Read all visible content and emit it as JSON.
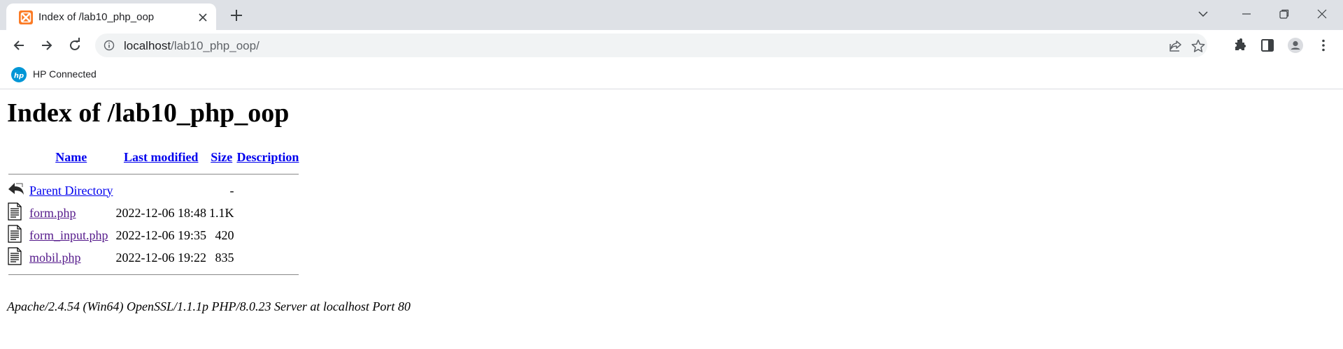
{
  "browser": {
    "tab": {
      "title": "Index of /lab10_php_oop",
      "favicon": "xampp-icon"
    },
    "address_bar": {
      "host": "localhost",
      "path": "/lab10_php_oop/"
    },
    "bookmarks": [
      {
        "label": "HP Connected",
        "icon": "hp-logo-icon"
      }
    ]
  },
  "page": {
    "heading": "Index of /lab10_php_oop",
    "columns": {
      "name": "Name",
      "last_modified": "Last modified",
      "size": "Size",
      "description": "Description"
    },
    "rows": [
      {
        "name": "Parent Directory",
        "modified": "",
        "size": "-",
        "icon": "back-arrow-icon",
        "visited": false
      },
      {
        "name": "form.php",
        "modified": "2022-12-06 18:48",
        "size": "1.1K",
        "icon": "file-text-icon",
        "visited": true
      },
      {
        "name": "form_input.php",
        "modified": "2022-12-06 19:35",
        "size": "420",
        "icon": "file-text-icon",
        "visited": true
      },
      {
        "name": "mobil.php",
        "modified": "2022-12-06 19:22",
        "size": "835",
        "icon": "file-text-icon",
        "visited": true
      }
    ],
    "server_signature": "Apache/2.4.54 (Win64) OpenSSL/1.1.1p PHP/8.0.23 Server at localhost Port 80"
  },
  "colors": {
    "link": "#0000ee",
    "visited_link": "#551a8b",
    "tabstrip": "#dee1e6",
    "omnibox": "#f1f3f4"
  }
}
